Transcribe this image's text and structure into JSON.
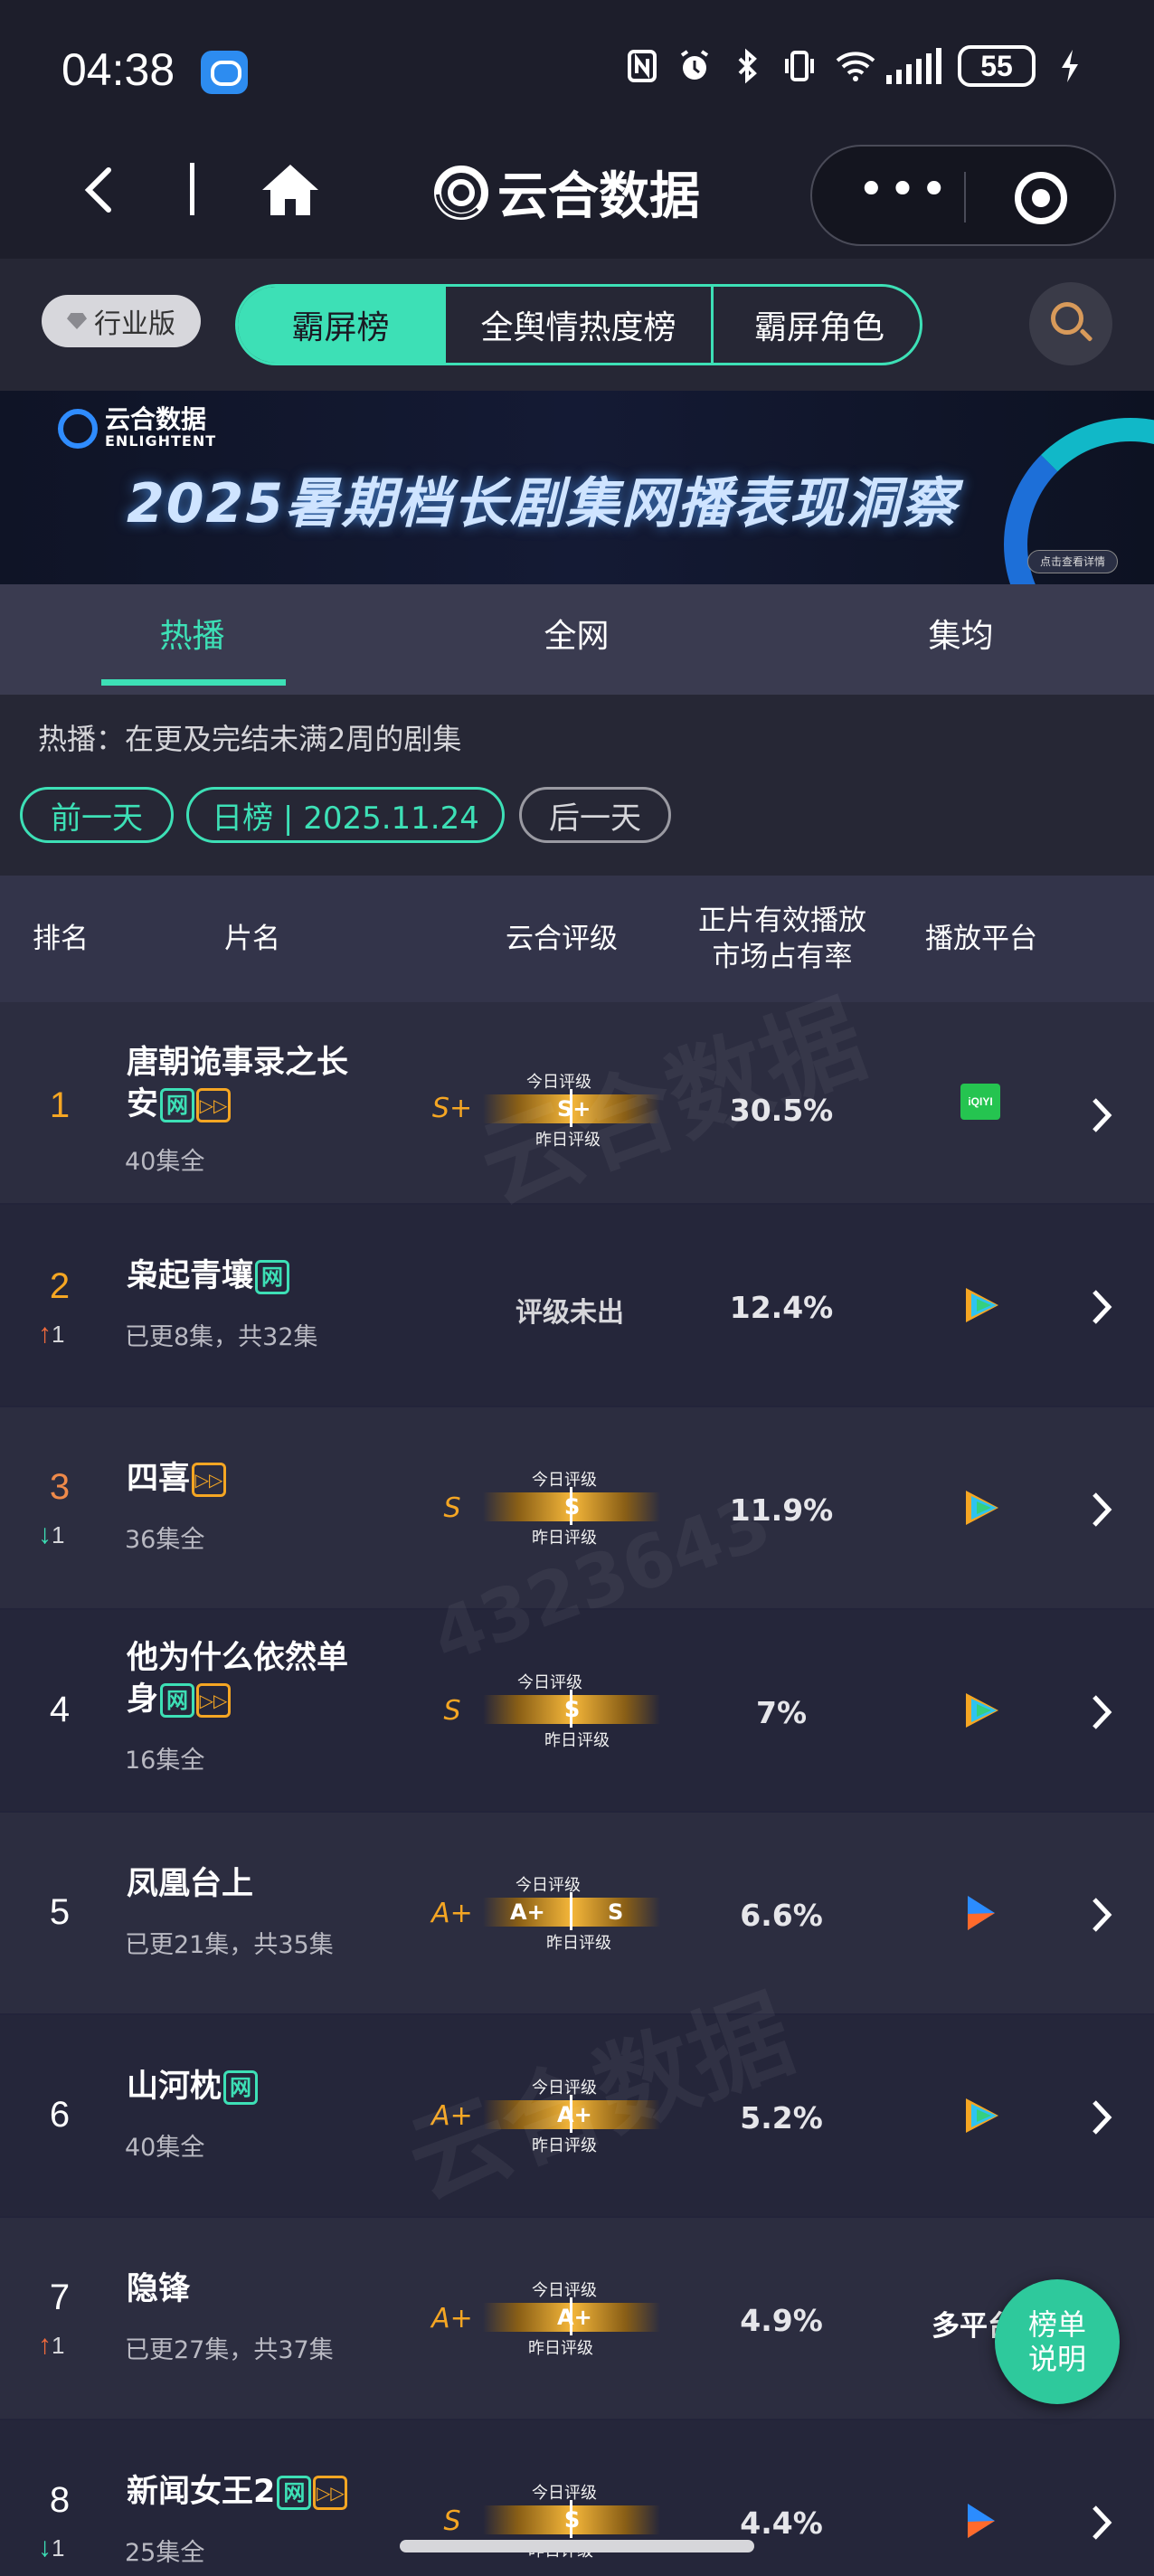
{
  "status_bar": {
    "time": "04:38",
    "battery": "55",
    "icons": [
      "chat-app-icon",
      "nfc-icon",
      "alarm-icon",
      "bluetooth-icon",
      "vibrate-icon",
      "wifi-icon",
      "signal-icon",
      "battery-icon",
      "charging-icon"
    ]
  },
  "nav": {
    "title": "云合数据"
  },
  "top_tabs": {
    "edition": "行业版",
    "tabs": [
      {
        "label": "霸屏榜",
        "active": true
      },
      {
        "label": "全舆情热度榜",
        "active": false
      },
      {
        "label": "霸屏角色",
        "active": false
      }
    ]
  },
  "banner": {
    "logo_cn": "云合数据",
    "logo_en": "ENLIGHTENT",
    "title": "2025暑期档长剧集网播表现洞察",
    "cta": "点击查看详情"
  },
  "sub_tabs": [
    {
      "label": "热播",
      "active": true
    },
    {
      "label": "全网",
      "active": false
    },
    {
      "label": "集均",
      "active": false
    }
  ],
  "description": "热播：在更及完结未满2周的剧集",
  "date_nav": {
    "prev": "前一天",
    "current": "日榜 | 2025.11.24",
    "next": "后一天"
  },
  "table": {
    "headers": {
      "rank": "排名",
      "title": "片名",
      "grade": "云合评级",
      "share_line1": "正片有效播放",
      "share_line2": "市场占有率",
      "platform": "播放平台"
    },
    "grade_today_label": "今日评级",
    "grade_yesterday_label": "昨日评级",
    "rows": [
      {
        "rank": "1",
        "title_l1": "唐朝诡事录之长",
        "title_l2": "安",
        "badges": [
          "网",
          "▷"
        ],
        "sub": "40集全",
        "grade": "S+",
        "today": "S+",
        "yesterday": "",
        "share": "30.5%",
        "platform": "iqiyi",
        "platform_text": "iQIYI",
        "change": "",
        "dir": ""
      },
      {
        "rank": "2",
        "title_l1": "枭起青壤",
        "title_l2": "",
        "badges": [
          "网"
        ],
        "sub": "已更8集，共32集",
        "grade": "",
        "no_grade": "评级未出",
        "share": "12.4%",
        "platform": "tencent",
        "change": "1",
        "dir": "up"
      },
      {
        "rank": "3",
        "title_l1": "四喜",
        "title_l2": "",
        "badges": [
          "▷"
        ],
        "sub": "36集全",
        "grade": "S",
        "today": "S",
        "yesterday": "",
        "share": "11.9%",
        "platform": "tencent",
        "change": "1",
        "dir": "down"
      },
      {
        "rank": "4",
        "title_l1": "他为什么依然单",
        "title_l2": "身",
        "badges": [
          "网",
          "▷"
        ],
        "sub": "16集全",
        "grade": "S",
        "today": "S",
        "yesterday": "",
        "share": "7%",
        "platform": "tencent",
        "change": "",
        "dir": ""
      },
      {
        "rank": "5",
        "title_l1": "凤凰台上",
        "title_l2": "",
        "badges": [],
        "sub": "已更21集，共35集",
        "grade": "A+",
        "today": "A+",
        "yesterday": "S",
        "share": "6.6%",
        "platform": "youku",
        "change": "",
        "dir": ""
      },
      {
        "rank": "6",
        "title_l1": "山河枕",
        "title_l2": "",
        "badges": [
          "网"
        ],
        "sub": "40集全",
        "grade": "A+",
        "today": "A+",
        "yesterday": "",
        "share": "5.2%",
        "platform": "tencent",
        "change": "",
        "dir": ""
      },
      {
        "rank": "7",
        "title_l1": "隐锋",
        "title_l2": "",
        "badges": [],
        "sub": "已更27集，共37集",
        "grade": "A+",
        "today": "A+",
        "yesterday": "",
        "share": "4.9%",
        "platform": "multi",
        "platform_text": "多平台",
        "change": "1",
        "dir": "up"
      },
      {
        "rank": "8",
        "title_l1": "新闻女王2",
        "title_l2": "",
        "badges": [
          "网",
          "▷"
        ],
        "sub": "25集全",
        "grade": "S",
        "today": "S",
        "yesterday": "",
        "share": "4.4%",
        "platform": "youku",
        "change": "1",
        "dir": "down"
      }
    ]
  },
  "fab": {
    "line1": "榜单",
    "line2": "说明"
  },
  "watermarks": [
    "云合数据",
    "ENLIGHTENT",
    "4323643"
  ],
  "colors": {
    "accent": "#3de0b6",
    "gold": "#f5a623",
    "up": "#f06a3c",
    "down": "#3de0b6"
  }
}
